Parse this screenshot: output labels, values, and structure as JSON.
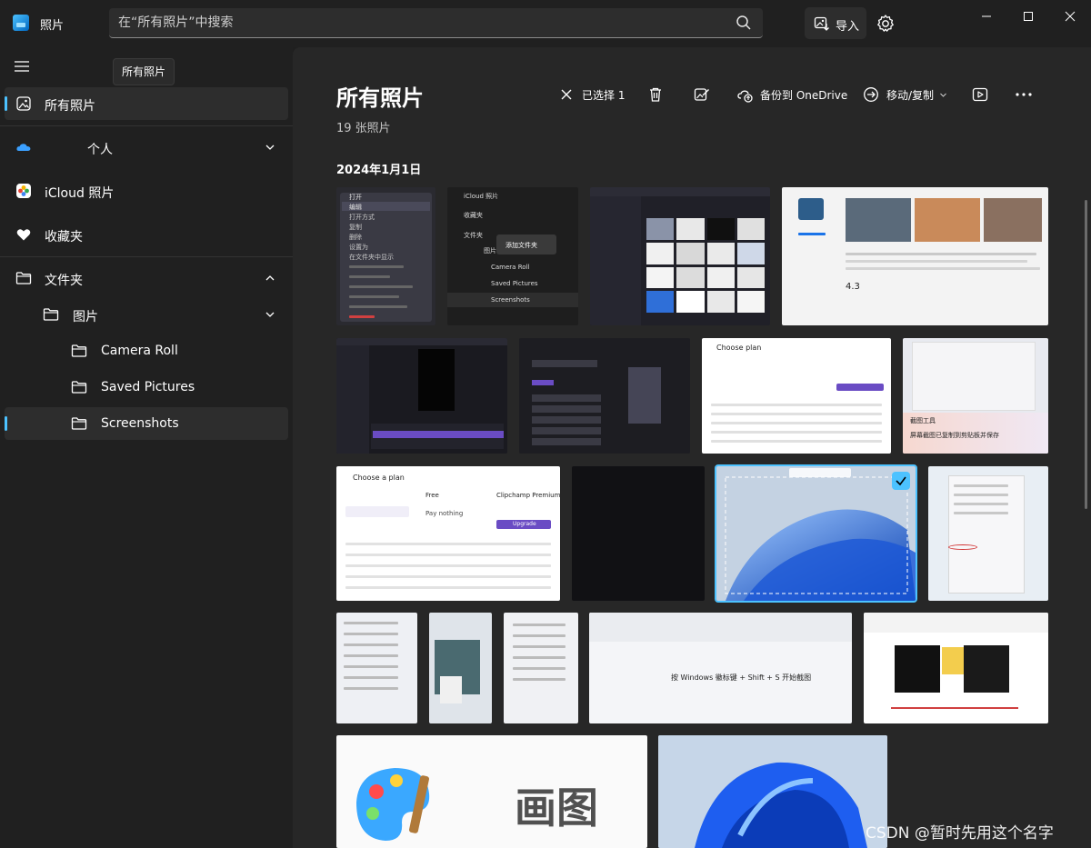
{
  "titlebar": {
    "app_title": "照片",
    "search_placeholder": "在“所有照片”中搜索",
    "import_label": "导入"
  },
  "sidebar": {
    "tooltip": "所有照片",
    "items": [
      {
        "label": "所有照片",
        "icon": "photos-icon",
        "active": true
      },
      {
        "label": "个人",
        "icon": "onedrive-cloud-icon"
      },
      {
        "label": "iCloud 照片",
        "icon": "icloud-photos-icon"
      },
      {
        "label": "收藏夹",
        "icon": "heart-icon"
      },
      {
        "label": "文件夹",
        "icon": "folder-icon"
      },
      {
        "label": "图片",
        "icon": "folder-icon"
      },
      {
        "label": "Camera Roll",
        "icon": "folder-icon"
      },
      {
        "label": "Saved Pictures",
        "icon": "folder-icon"
      },
      {
        "label": "Screenshots",
        "icon": "folder-icon",
        "selected": true
      }
    ]
  },
  "main": {
    "title": "所有照片",
    "count": "19 张照片",
    "date_group": "2024年1月1日",
    "toolbar": {
      "deselect_label": "已选择 1",
      "backup_label": "备份到 OneDrive",
      "move_copy_label": "移动/复制"
    },
    "thumbnails": {
      "t1_menu": [
        "打开",
        "编辑",
        "打开方式",
        "复制",
        "删除",
        "设置为",
        "在文件夹中显示"
      ],
      "t2_items": [
        "iCloud 照片",
        "收藏夹",
        "文件夹",
        "图片",
        "Camera Roll",
        "Saved Pictures",
        "Screenshots"
      ],
      "t2_button": "添加文件夹",
      "t4_rating": "4.3",
      "t7_title": "Choose plan",
      "t8_toast_title": "截图工具",
      "t8_toast_body": "屏幕截图已复制到剪贴板并保存",
      "t9_title": "Choose a plan",
      "t9_free": "Free",
      "t9_premium": "Clipchamp Premium",
      "t9_pay": "Pay nothing",
      "t9_upgrade": "Upgrade",
      "t15_hint": "按 Windows 徽标键 + Shift + S 开始截图",
      "t18_text": "画图"
    }
  },
  "watermark": "CSDN @暂时先用这个名字",
  "colors": {
    "accent": "#4cc2ff",
    "sidebar_bg": "#202020",
    "content_bg": "#272727"
  }
}
